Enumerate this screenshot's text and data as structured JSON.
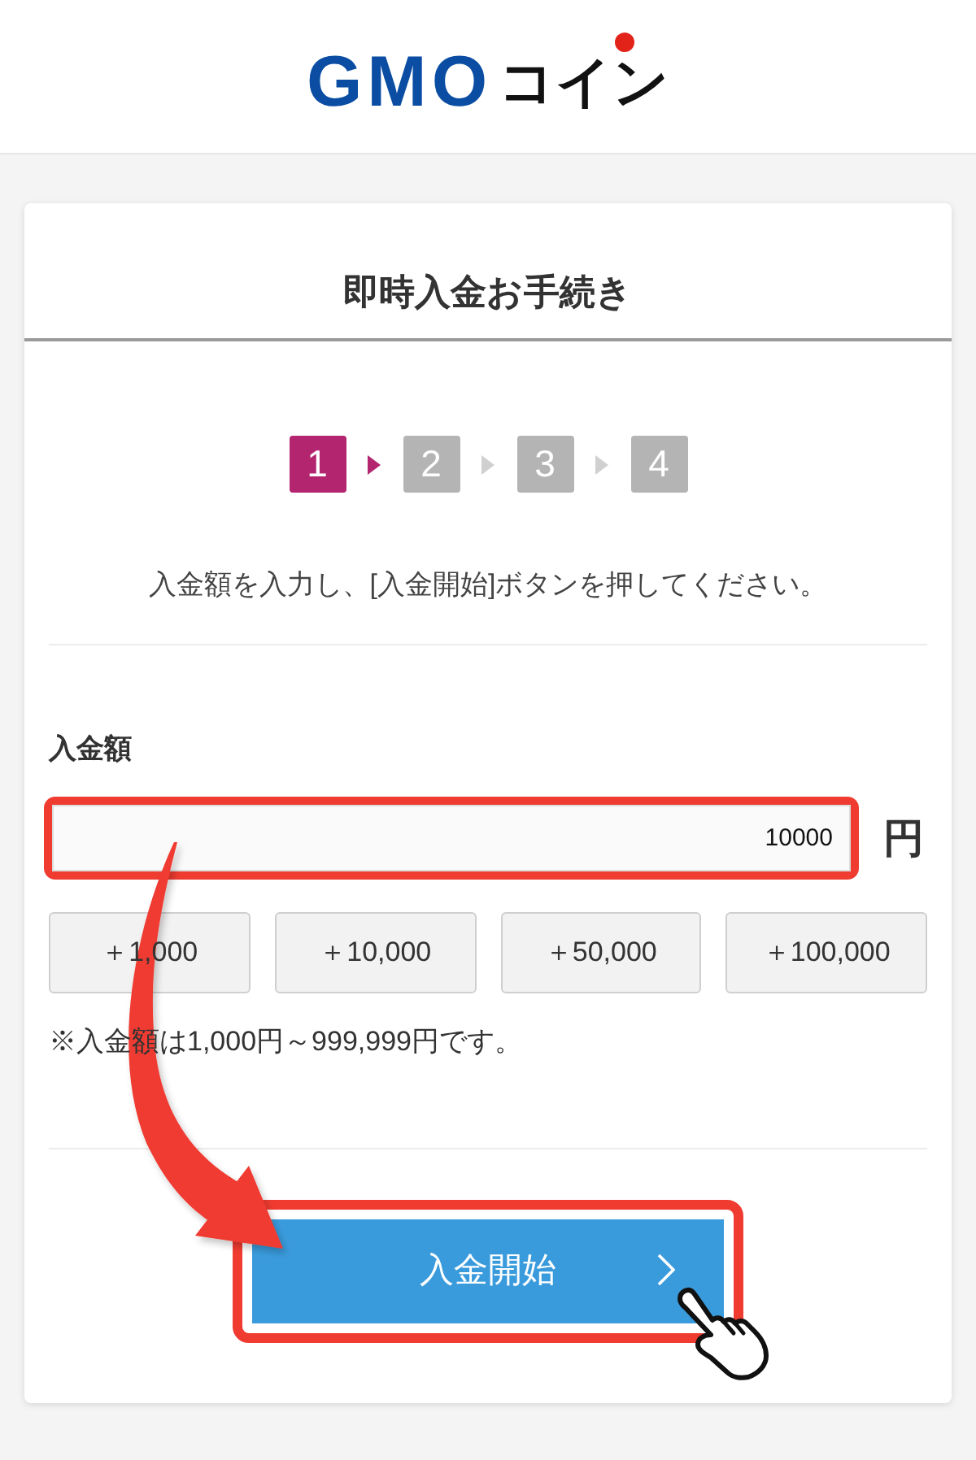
{
  "header": {
    "logo": {
      "latin": "GMO",
      "katakana": "コイン"
    }
  },
  "card": {
    "title": "即時入金お手続き",
    "steps": [
      {
        "label": "1",
        "selected": true
      },
      {
        "label": "2",
        "selected": false
      },
      {
        "label": "3",
        "selected": false
      },
      {
        "label": "4",
        "selected": false
      }
    ],
    "instruction": "入金額を入力し、[入金開始]ボタンを押してください。",
    "amount": {
      "label": "入金額",
      "value": "10000",
      "unit": "円"
    },
    "quick_amounts": [
      "＋1,000",
      "＋10,000",
      "＋50,000",
      "＋100,000"
    ],
    "note": "※入金額は1,000円～999,999円です。",
    "submit": {
      "label": "入金開始"
    }
  }
}
